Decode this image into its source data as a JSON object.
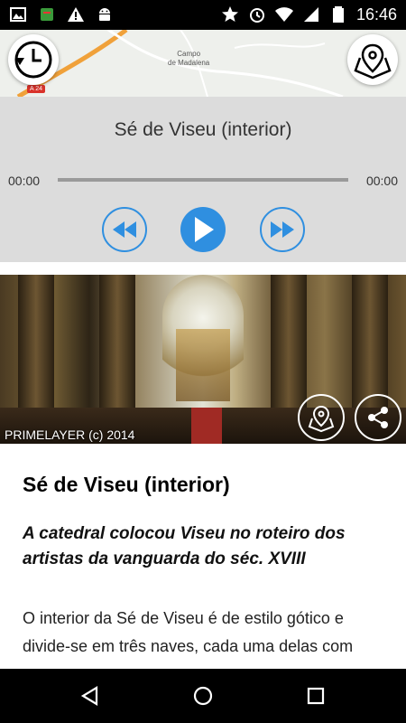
{
  "status_bar": {
    "time": "16:46",
    "left_icons": [
      "image-icon",
      "app-icon",
      "warning-icon",
      "android-icon"
    ],
    "right_icons": [
      "star-icon",
      "alarm-icon",
      "wifi-icon",
      "signal-icon",
      "battery-icon"
    ]
  },
  "map": {
    "place_label": "Campo\nde Madalena",
    "road_badge": "A 24"
  },
  "player": {
    "title": "Sé de Viseu (interior)",
    "current_time": "00:00",
    "duration": "00:00",
    "progress": 0,
    "accent_color": "#2f8fe0"
  },
  "photo": {
    "credit": "PRIMELAYER (c) 2014"
  },
  "article": {
    "title": "Sé de Viseu (interior)",
    "subtitle": "A catedral colocou Viseu no roteiro dos artistas da vanguarda do séc. XVIII",
    "body": "O interior da Sé de Viseu é de estilo gótico e divide-se em três naves, cada uma delas com"
  }
}
